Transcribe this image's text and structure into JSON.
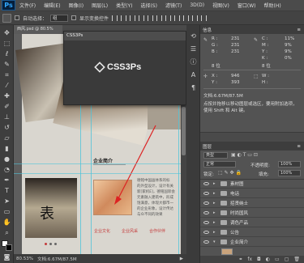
{
  "app": {
    "logo": "Ps",
    "accent": "#31a8ff"
  },
  "menubar": {
    "items": [
      "文件(F)",
      "编辑(E)",
      "图像(I)",
      "图层(L)",
      "类型(Y)",
      "选择(S)",
      "滤镜(T)",
      "3D(D)",
      "视图(V)",
      "窗口(W)",
      "帮助(H)"
    ]
  },
  "options": {
    "auto_select_label": "自动选择：",
    "auto_select_value": "组",
    "show_transform_label": "显示变换控件"
  },
  "document": {
    "tab_title": "西风.psd @ 80.5%",
    "zoom": "80.53%",
    "doc_size": "文档:6.67M/87.5M"
  },
  "css3ps_panel": {
    "title": "CSS3Ps",
    "logo_text": "CSS3Ps"
  },
  "canvas_page": {
    "section_title": "企业简介",
    "body_lines": [
      "德铭中国画体系的标",
      "的外型设计，设计有关",
      "新[家机E]，德铭国际会",
      "元素融入建筑中，形成",
      "饱满意，体现大都市一",
      "的企业形象，设计传达",
      "与众不同的效果"
    ],
    "links": [
      "企业文化",
      "企业风采",
      "合作伙伴"
    ],
    "callout_char": "表"
  },
  "info_panel": {
    "tabs": "信息",
    "rgb": {
      "r_label": "R :",
      "r": "231",
      "g_label": "G :",
      "g": "231",
      "b_label": "B :",
      "b": "231"
    },
    "cmyk": {
      "c_label": "C :",
      "c": "11%",
      "m_label": "M :",
      "m": "9%",
      "y_label": "Y :",
      "y": "9%",
      "k_label": "K :",
      "k": "0%"
    },
    "bitdepth_1": "8 位",
    "bitdepth_2": "8 位",
    "xy": {
      "x_label": "X :",
      "x": "946",
      "y_label": "Y :",
      "y": "393"
    },
    "wh": {
      "w_label": "W :",
      "h_label": "H :"
    },
    "doc_size": "文档:6.67M/87.5M",
    "hint": "点按并拖移以移动图层或选区，要用附加选项，使用 Shift 和 Alt 键。"
  },
  "layers_panel": {
    "tab": "图层",
    "kind_label": "类型",
    "blend_mode": "正常",
    "opacity_label": "不透明度:",
    "opacity": "100%",
    "lock_label": "锁定:",
    "fill_label": "填充:",
    "fill": "100%",
    "layers": [
      "素材图",
      "电话",
      "招贤纳士",
      "时尚国风",
      "调色产品",
      "公告",
      "企业简介"
    ]
  }
}
